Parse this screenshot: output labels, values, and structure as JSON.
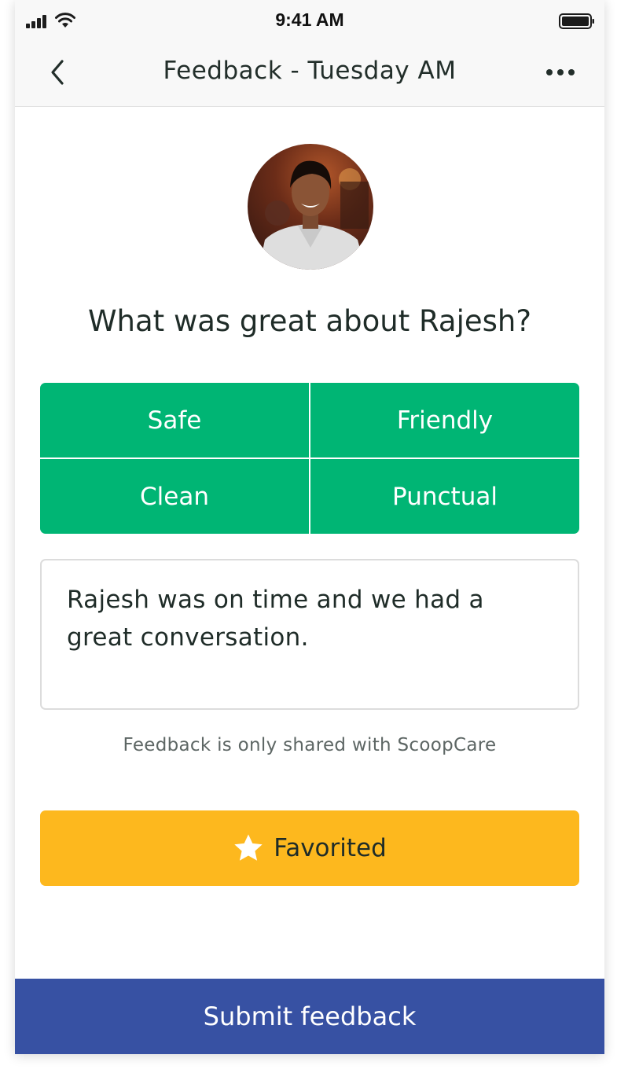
{
  "status_bar": {
    "time": "9:41 AM"
  },
  "nav": {
    "title": "Feedback - Tuesday AM",
    "back_icon": "chevron-left-icon",
    "more_icon": "more-horizontal-icon"
  },
  "profile": {
    "avatar": "person-photo"
  },
  "question": "What was great about Rajesh?",
  "tags": [
    {
      "label": "Safe"
    },
    {
      "label": "Friendly"
    },
    {
      "label": "Clean"
    },
    {
      "label": "Punctual"
    }
  ],
  "comment": {
    "value": "Rajesh was on time and we had a great conversation."
  },
  "note": "Feedback is only shared with ScoopCare",
  "favorite": {
    "label": "Favorited",
    "icon": "star-icon"
  },
  "submit": {
    "label": "Submit feedback"
  },
  "colors": {
    "tag_green": "#00b574",
    "favorite_yellow": "#fdb81e",
    "submit_blue": "#3751a3",
    "text_dark": "#1f2c28"
  }
}
